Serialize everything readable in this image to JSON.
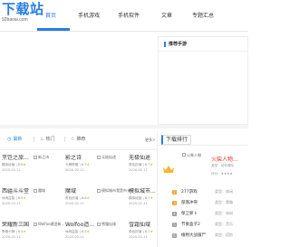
{
  "logo": {
    "main": "下载站",
    "sub": "92baoai.com"
  },
  "nav": {
    "items": [
      "首页",
      "手机游戏",
      "手机软件",
      "文章",
      "专题汇总"
    ]
  },
  "recommend": {
    "title": "推荐手游"
  },
  "tabs": {
    "items": [
      "最新",
      "热门",
      "推荐"
    ],
    "more": "更多>"
  },
  "cards": [
    {
      "title": "烹饪之旅...",
      "meta": "模拟经营 | 8.6",
      "date": "2020-02-11",
      "img": ""
    },
    {
      "title": "",
      "meta": "",
      "date": "",
      "img": "新之诗"
    },
    {
      "title": "影之诗",
      "meta": "卡牌策略 | 8.7",
      "date": "2020-02-11",
      "img": ""
    },
    {
      "title": "",
      "meta": "",
      "date": "",
      "img": "无极仙途"
    },
    {
      "title": "无极仙途",
      "meta": "角色扮演 | 8.7",
      "date": "2020-02-11",
      "img": ""
    },
    {
      "title": "西疆斗斗堂",
      "meta": "休闲益智 | 8.5",
      "date": "2020-02-11",
      "img": ""
    },
    {
      "title": "",
      "meta": "",
      "date": "",
      "img": "魔域"
    },
    {
      "title": "魔域",
      "meta": "角色扮演 | 8.6",
      "date": "2020-02-11",
      "img": ""
    },
    {
      "title": "",
      "meta": "",
      "date": "",
      "img": "模拟城市我是市长"
    },
    {
      "title": "模拟城市...",
      "meta": "模拟经营 | 8.7",
      "date": "2020-02-11",
      "img": ""
    },
    {
      "title": "荣耀新三国",
      "meta": "策略卡牌 | 8.5",
      "date": "2020-02-11",
      "img": ""
    },
    {
      "title": "",
      "meta": "",
      "date": "",
      "img": "Wolfoo建造新..."
    },
    {
      "title": "Wolfoo造...",
      "meta": "休闲益智 | 8.5",
      "date": "2020-02-11",
      "img": ""
    },
    {
      "title": "",
      "meta": "",
      "date": "",
      "img": "雪霜仙域"
    },
    {
      "title": "雪霜仙域",
      "meta": "角色扮演 | 8.7",
      "date": "2020-02-11",
      "img": ""
    }
  ],
  "ranking": {
    "title": "下载排行",
    "top": {
      "img": "火柴人物",
      "title": "火柴人物...",
      "meta1": "类型：动作冒险",
      "meta2": "评分：★★★★"
    },
    "rows": [
      {
        "num": "2",
        "name": "277游戏",
        "cat": "类型：休闲"
      },
      {
        "num": "3",
        "name": "部落冲突",
        "cat": "类型：策略"
      },
      {
        "num": "4",
        "name": "保卫萝卜",
        "cat": "类型：休闲"
      },
      {
        "num": "5",
        "name": "节奏盒子2",
        "cat": "类型：音乐"
      },
      {
        "num": "6",
        "name": "植物大战僵尸",
        "cat": "类型：塔防"
      }
    ]
  },
  "colors": {
    "accent": "#2a7de1",
    "star": "#f5a623",
    "rank_top": "#e33333",
    "rank_other": "#f0a030",
    "rank_low": "#999999"
  }
}
